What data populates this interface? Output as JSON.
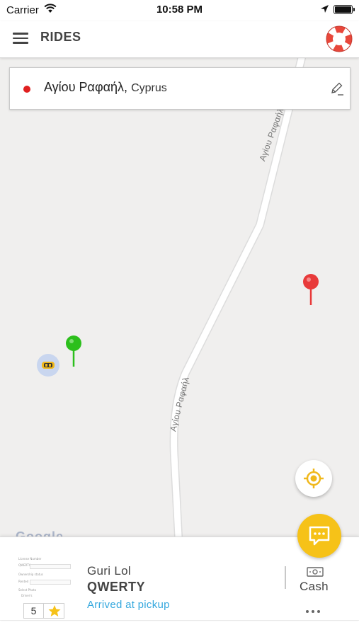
{
  "status_bar": {
    "carrier": "Carrier",
    "time": "10:58 PM"
  },
  "header": {
    "title": "RIDES"
  },
  "search": {
    "place": "Αγίου Ραφαήλ",
    "country": "Cyprus",
    "dot_color": "#e02020"
  },
  "map": {
    "road_label_top": "Αγίου Ραφαήλ",
    "road_label_bottom": "Αγίου Ραφαήλ",
    "pickup_pin_color": "#2cbf1c",
    "destination_pin_color": "#e83a3a",
    "attribution": "Google"
  },
  "driver": {
    "name": "Guri Lol",
    "plate": "QWERTY",
    "status": "Arrived at pickup",
    "rating": "5",
    "status_color": "#35a8de",
    "photo_lines": {
      "l1": "License Number",
      "l2": "QWERTY",
      "l3": "Ownership status",
      "l4": "Rented",
      "l5": "Select Photo",
      "l6": "Driver's"
    }
  },
  "payment": {
    "method": "Cash"
  },
  "colors": {
    "accent": "#f6c218",
    "help_red": "#e8473b"
  }
}
